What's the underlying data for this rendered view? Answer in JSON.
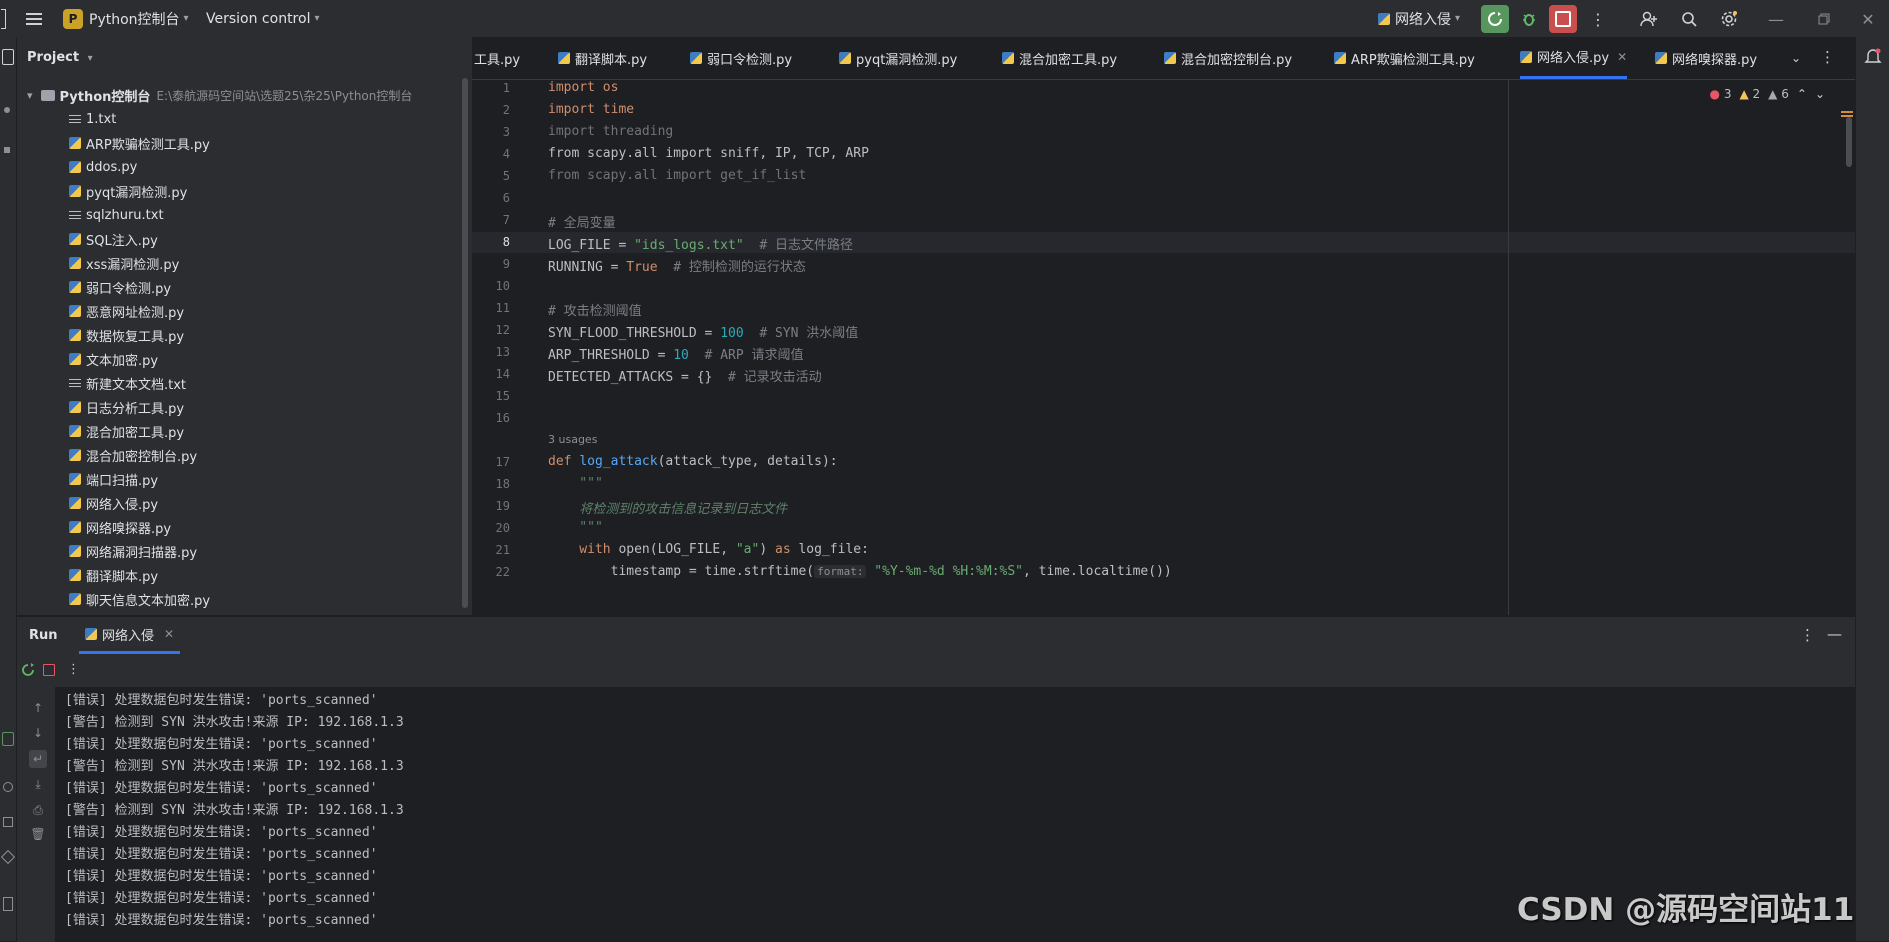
{
  "titlebar": {
    "project_badge": "P",
    "project_name": "Python控制台",
    "version_control": "Version control",
    "run_config": "网络入侵"
  },
  "project_panel": {
    "header": "Project",
    "root_name": "Python控制台",
    "root_path": "E:\\泰航源码空间站\\选题25\\杂25\\Python控制台",
    "files": [
      {
        "name": "1.txt",
        "type": "txt"
      },
      {
        "name": "ARP欺骗检测工具.py",
        "type": "py"
      },
      {
        "name": "ddos.py",
        "type": "py"
      },
      {
        "name": "pyqt漏洞检测.py",
        "type": "py"
      },
      {
        "name": "sqlzhuru.txt",
        "type": "txt"
      },
      {
        "name": "SQL注入.py",
        "type": "py"
      },
      {
        "name": "xss漏洞检测.py",
        "type": "py"
      },
      {
        "name": "弱口令检测.py",
        "type": "py"
      },
      {
        "name": "恶意网址检测.py",
        "type": "py"
      },
      {
        "name": "数据恢复工具.py",
        "type": "py"
      },
      {
        "name": "文本加密.py",
        "type": "py"
      },
      {
        "name": "新建文本文档.txt",
        "type": "txt"
      },
      {
        "name": "日志分析工具.py",
        "type": "py"
      },
      {
        "name": "混合加密工具.py",
        "type": "py"
      },
      {
        "name": "混合加密控制台.py",
        "type": "py"
      },
      {
        "name": "端口扫描.py",
        "type": "py"
      },
      {
        "name": "网络入侵.py",
        "type": "py"
      },
      {
        "name": "网络嗅探器.py",
        "type": "py"
      },
      {
        "name": "网络漏洞扫描器.py",
        "type": "py"
      },
      {
        "name": "翻译脚本.py",
        "type": "py"
      },
      {
        "name": "聊天信息文本加密.py",
        "type": "py"
      }
    ]
  },
  "editor": {
    "tabs": [
      {
        "label": "工具.py",
        "active": false
      },
      {
        "label": "翻译脚本.py",
        "active": false
      },
      {
        "label": "弱口令检测.py",
        "active": false
      },
      {
        "label": "pyqt漏洞检测.py",
        "active": false
      },
      {
        "label": "混合加密工具.py",
        "active": false
      },
      {
        "label": "混合加密控制台.py",
        "active": false
      },
      {
        "label": "ARP欺骗检测工具.py",
        "active": false
      },
      {
        "label": "网络入侵.py",
        "active": true
      },
      {
        "label": "网络嗅探器.py",
        "active": false
      }
    ],
    "inspections": {
      "errors": "3",
      "warnings": "2",
      "weak_warnings": "6"
    },
    "usages_hint": "3 usages",
    "param_hint": "format:",
    "current_line": 8,
    "line_numbers": [
      "1",
      "2",
      "3",
      "4",
      "5",
      "6",
      "7",
      "8",
      "9",
      "10",
      "11",
      "12",
      "13",
      "14",
      "15",
      "16",
      "17",
      "18",
      "19",
      "20",
      "21",
      "22"
    ],
    "code": {
      "l1": "import os",
      "l2": "import time",
      "l3": "import threading",
      "l4": "from scapy.all import sniff, IP, TCP, ARP",
      "l5": "from scapy.all import get_if_list",
      "l7": "# 全局变量",
      "l8a": "LOG_FILE = ",
      "l8b": "\"ids_logs.txt\"",
      "l8c": "  # 日志文件路径",
      "l9a": "RUNNING = ",
      "l9b": "True",
      "l9c": "  # 控制检测的运行状态",
      "l11": "# 攻击检测阈值",
      "l12a": "SYN_FLOOD_THRESHOLD = ",
      "l12b": "100",
      "l12c": "  # SYN 洪水阈值",
      "l13a": "ARP_THRESHOLD = ",
      "l13b": "10",
      "l13c": "  # ARP 请求阈值",
      "l14a": "DETECTED_ATTACKS = {}",
      "l14c": "  # 记录攻击活动",
      "l17a": "def ",
      "l17b": "log_attack",
      "l17c": "(attack_type, details):",
      "l18": "    \"\"\"",
      "l19": "    将检测到的攻击信息记录到日志文件",
      "l20": "    \"\"\"",
      "l21a": "    with ",
      "l21b": "open",
      "l21c": "(LOG_FILE, ",
      "l21d": "\"a\"",
      "l21e": ") ",
      "l21f": "as",
      "l21g": " log_file:",
      "l22a": "        timestamp = time.strftime(",
      "l22b": "\"%Y-%m-%d %H:%M:%S\"",
      "l22c": ", time.localtime())"
    }
  },
  "run_panel": {
    "title": "Run",
    "tab_label": "网络入侵",
    "console_lines": [
      "[错误] 处理数据包时发生错误: 'ports_scanned'",
      "[警告] 检测到 SYN 洪水攻击!来源 IP: 192.168.1.3",
      "[错误] 处理数据包时发生错误: 'ports_scanned'",
      "[警告] 检测到 SYN 洪水攻击!来源 IP: 192.168.1.3",
      "[错误] 处理数据包时发生错误: 'ports_scanned'",
      "[警告] 检测到 SYN 洪水攻击!来源 IP: 192.168.1.3",
      "[错误] 处理数据包时发生错误: 'ports_scanned'",
      "[错误] 处理数据包时发生错误: 'ports_scanned'",
      "[错误] 处理数据包时发生错误: 'ports_scanned'",
      "[错误] 处理数据包时发生错误: 'ports_scanned'",
      "[错误] 处理数据包时发生错误: 'ports_scanned'"
    ]
  },
  "watermark": "CSDN @源码空间站11",
  "colors": {
    "accent": "#3574f0",
    "run_green": "#57965c",
    "stop_red": "#c94f4f",
    "error": "#e55765",
    "warning": "#f2c55c"
  }
}
